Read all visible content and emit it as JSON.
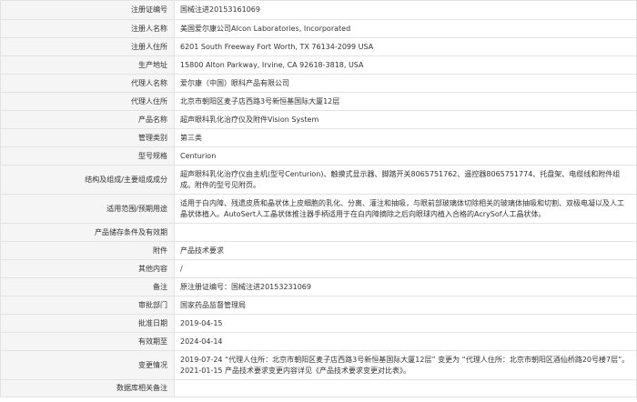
{
  "rows": [
    {
      "label": "注册证编号",
      "value": "国械注进20153161069"
    },
    {
      "label": "注册人名称",
      "value": "美国爱尔康公司Alcon Laboratories, Incorporated"
    },
    {
      "label": "注册人住所",
      "value": "6201 South Freeway Fort Worth, TX 76134-2099 USA"
    },
    {
      "label": "生产地址",
      "value": "15800 Alton Parkway, Irvine, CA 92618-3818, USA"
    },
    {
      "label": "代理人名称",
      "value": "爱尔康（中国）眼科产品有限公司"
    },
    {
      "label": "代理人住所",
      "value": "北京市朝阳区麦子店西路3号新恒基国际大厦12层"
    },
    {
      "label": "产品名称",
      "value": "超声眼科乳化治疗仪及附件Vision System"
    },
    {
      "label": "管理类别",
      "value": "第三类"
    },
    {
      "label": "型号规格",
      "value": "Centurion"
    },
    {
      "label": "结构及组成/主要组成成分",
      "value": "超声眼科乳化治疗仪由主机(型号Centurion)、触摸式显示器、脚踏开关8065751762、遥控器8065751774、托盘架、电缆线和附件组成。附件的型号见附页。"
    },
    {
      "label": "适用范围/预期用途",
      "value": "适用于白内障、残遗皮质和晶状体上皮细胞的乳化、分离、灌注和抽吸，与眼前部玻璃体切除相关的玻璃体抽吸和切割、双极电凝以及人工晶状体植入。AutoSert人工晶状体推注器手柄适用于在白内障摘除之后向眼球内植入合格的AcrySof人工晶状体。"
    },
    {
      "label": "产品储存条件及有效期",
      "value": ""
    },
    {
      "label": "附件",
      "value": "产品技术要求"
    },
    {
      "label": "其他内容",
      "value": "/"
    },
    {
      "label": "备注",
      "value": "原注册证编号：国械注进20153231069"
    },
    {
      "label": "审批部门",
      "value": "国家药品监督管理局"
    },
    {
      "label": "批准日期",
      "value": "2019-04-15"
    },
    {
      "label": "有效期至",
      "value": "2024-04-14"
    },
    {
      "label": "变更情况",
      "value": "2019-07-24 “代理人住所：北京市朝阳区麦子店西路3号新恒基国际大厦12层” 变更为 “代理人住所：北京市朝阳区酒仙桥路20号楼7层”。 2021-01-15 产品技术要求变更内容详见《产品技术要求变更对比表》。"
    },
    {
      "label": "数据库相关备注",
      "value": ""
    }
  ]
}
